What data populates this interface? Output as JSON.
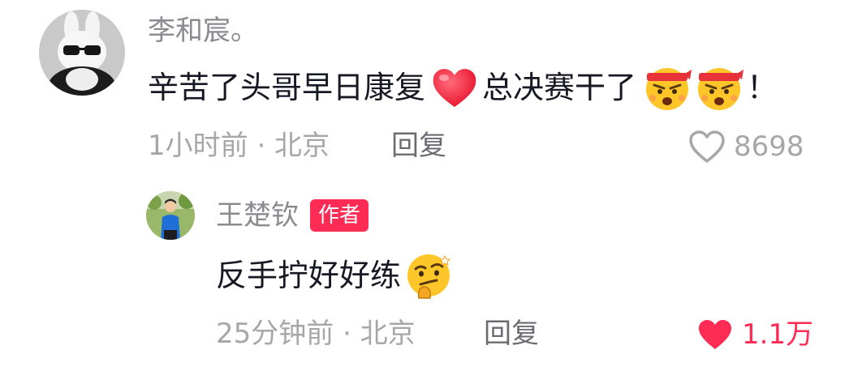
{
  "comment": {
    "author": "李和宸。",
    "text_part1": "辛苦了头哥早日康复",
    "text_part2": "总决赛干了",
    "text_end": "！",
    "time_location": "1小时前 · 北京",
    "reply_label": "回复",
    "like_count": "8698",
    "liked": false,
    "emoji_icons": [
      "red-heart-emoji",
      "angry-headband-emoji",
      "angry-headband-emoji"
    ]
  },
  "reply": {
    "author": "王楚钦",
    "author_badge": "作者",
    "text": "反手拧好好练",
    "time_location": "25分钟前 · 北京",
    "reply_label": "回复",
    "like_count": "1.1万",
    "liked": true,
    "emoji_icons": [
      "thinking-smirk-emoji"
    ]
  },
  "colors": {
    "accent": "#fe2c55",
    "meta": "#a6a7ab",
    "username": "#8a8b91",
    "text": "#161823"
  }
}
